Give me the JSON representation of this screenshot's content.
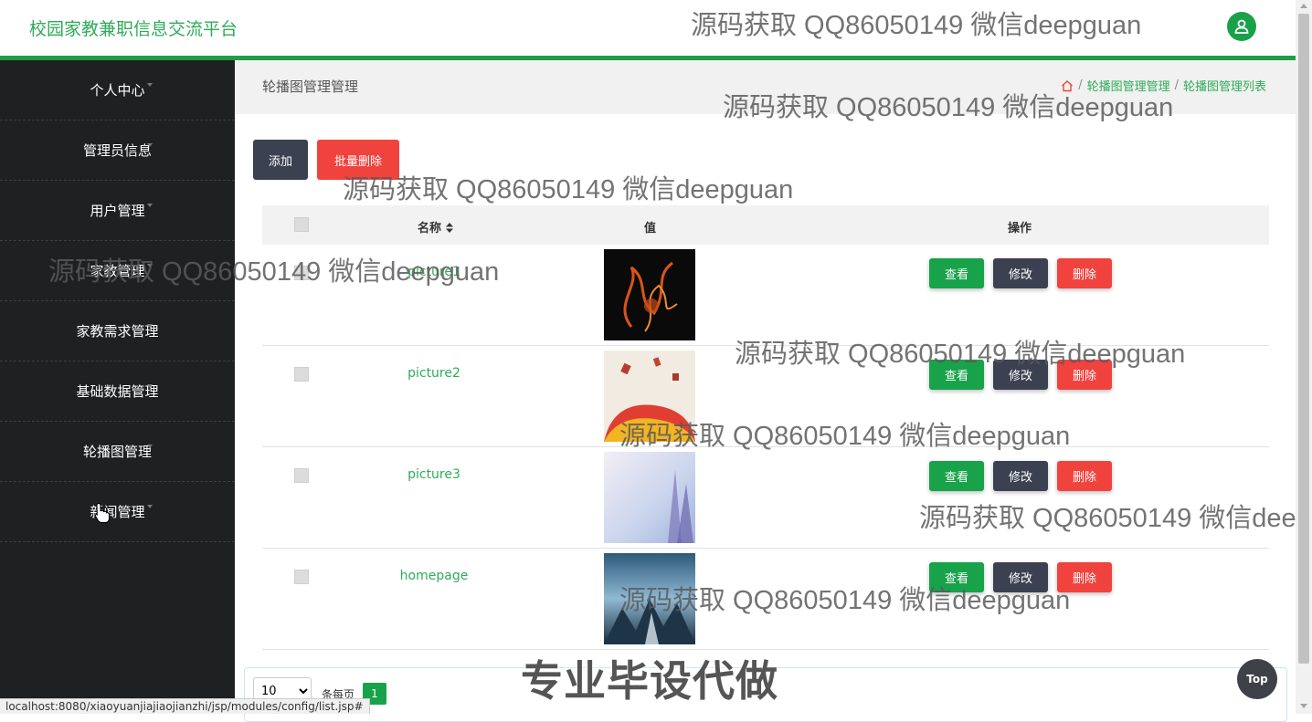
{
  "header": {
    "brand": "校园家教兼职信息交流平台",
    "avatar_icon": "user-icon"
  },
  "sidebar": {
    "items": [
      {
        "label": "个人中心"
      },
      {
        "label": "管理员信息"
      },
      {
        "label": "用户管理"
      },
      {
        "label": "家教管理"
      },
      {
        "label": "家教需求管理"
      },
      {
        "label": "基础数据管理"
      },
      {
        "label": "轮播图管理"
      },
      {
        "label": "新闻管理"
      }
    ]
  },
  "main": {
    "heading": "轮播图管理管理",
    "breadcrumb": {
      "home_icon": "home-icon",
      "sep": "/",
      "level1": "轮播图管理管理",
      "level2": "轮播图管理列表"
    },
    "toolbar": {
      "add": "添加",
      "batch_delete": "批量删除"
    },
    "table": {
      "col_name": "名称",
      "col_sort_icon": "sort-icon",
      "col_value": "值",
      "col_ops": "操作",
      "rows": [
        {
          "name": "picture1"
        },
        {
          "name": "picture2"
        },
        {
          "name": "picture3"
        },
        {
          "name": "homepage"
        }
      ],
      "ops": {
        "view": "查看",
        "edit": "修改",
        "delete": "删除"
      }
    },
    "pager": {
      "page_size": "10",
      "per_page": "条每页",
      "current": "1"
    }
  },
  "overlays": {
    "watermark": "源码获取 QQ86050149 微信deepguan",
    "banner": "专业毕设代做",
    "top_button": "Top",
    "status_url": "localhost:8080/xiaoyuanjiajiaojianzhi/jsp/modules/config/list.jsp#"
  },
  "colors": {
    "brand_green": "#2eac58",
    "primary_green": "#18a24a",
    "dark": "#3b4150",
    "danger": "#f0433e",
    "sidebar": "#1f2022"
  }
}
